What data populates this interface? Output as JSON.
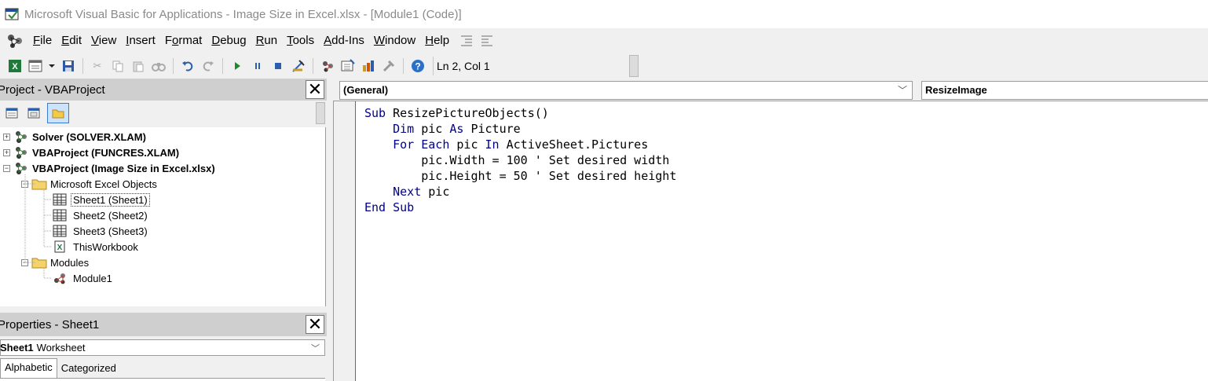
{
  "window": {
    "title": "Microsoft Visual Basic for Applications - Image Size in Excel.xlsx - [Module1 (Code)]"
  },
  "menu": {
    "items": [
      "File",
      "Edit",
      "View",
      "Insert",
      "Format",
      "Debug",
      "Run",
      "Tools",
      "Add-Ins",
      "Window",
      "Help"
    ],
    "access_keys": [
      "F",
      "E",
      "V",
      "I",
      "o",
      "D",
      "R",
      "T",
      "A",
      "W",
      "H"
    ]
  },
  "toolbar": {
    "status": "Ln 2, Col 1",
    "icons": [
      "excel-icon",
      "insert-module-icon",
      "dropdown-icon",
      "save-icon",
      "cut-icon",
      "copy-icon",
      "paste-icon",
      "find-icon",
      "undo-icon",
      "redo-icon",
      "run-icon",
      "break-icon",
      "reset-icon",
      "design-mode-icon",
      "project-explorer-icon",
      "properties-icon",
      "object-browser-icon",
      "toolbox-icon",
      "help-icon"
    ]
  },
  "project_panel": {
    "title": "Project - VBAProject",
    "tree": [
      {
        "label": "Solver (SOLVER.XLAM)",
        "bold": true,
        "expander": "+"
      },
      {
        "label": "VBAProject (FUNCRES.XLAM)",
        "bold": true,
        "expander": "+"
      },
      {
        "label": "VBAProject (Image Size in Excel.xlsx)",
        "bold": true,
        "expander": "−"
      },
      {
        "label": "Microsoft Excel Objects",
        "bold": false,
        "expander": "−"
      },
      {
        "label": "Sheet1 (Sheet1)",
        "bold": false,
        "selected": true
      },
      {
        "label": "Sheet2 (Sheet2)",
        "bold": false
      },
      {
        "label": "Sheet3 (Sheet3)",
        "bold": false
      },
      {
        "label": "ThisWorkbook",
        "bold": false
      },
      {
        "label": "Modules",
        "bold": false,
        "expander": "−"
      },
      {
        "label": "Module1",
        "bold": false
      }
    ]
  },
  "properties_panel": {
    "title": "Properties - Sheet1",
    "object_name": "Sheet1",
    "object_type": "Worksheet",
    "tabs": [
      "Alphabetic",
      "Categorized"
    ]
  },
  "code_window": {
    "object_combo": "(General)",
    "proc_combo": "ResizeImage",
    "lines": [
      "Sub ResizePictureObjects()",
      "    Dim pic As Picture",
      "    For Each pic In ActiveSheet.Pictures",
      "        pic.Width = 100 ' Set desired width",
      "        pic.Height = 50 ' Set desired height",
      "    Next pic",
      "End Sub"
    ]
  },
  "colors": {
    "keyword": "#00008b",
    "title_text": "#8a8a8a",
    "panel_header": "#cfcfcf"
  }
}
